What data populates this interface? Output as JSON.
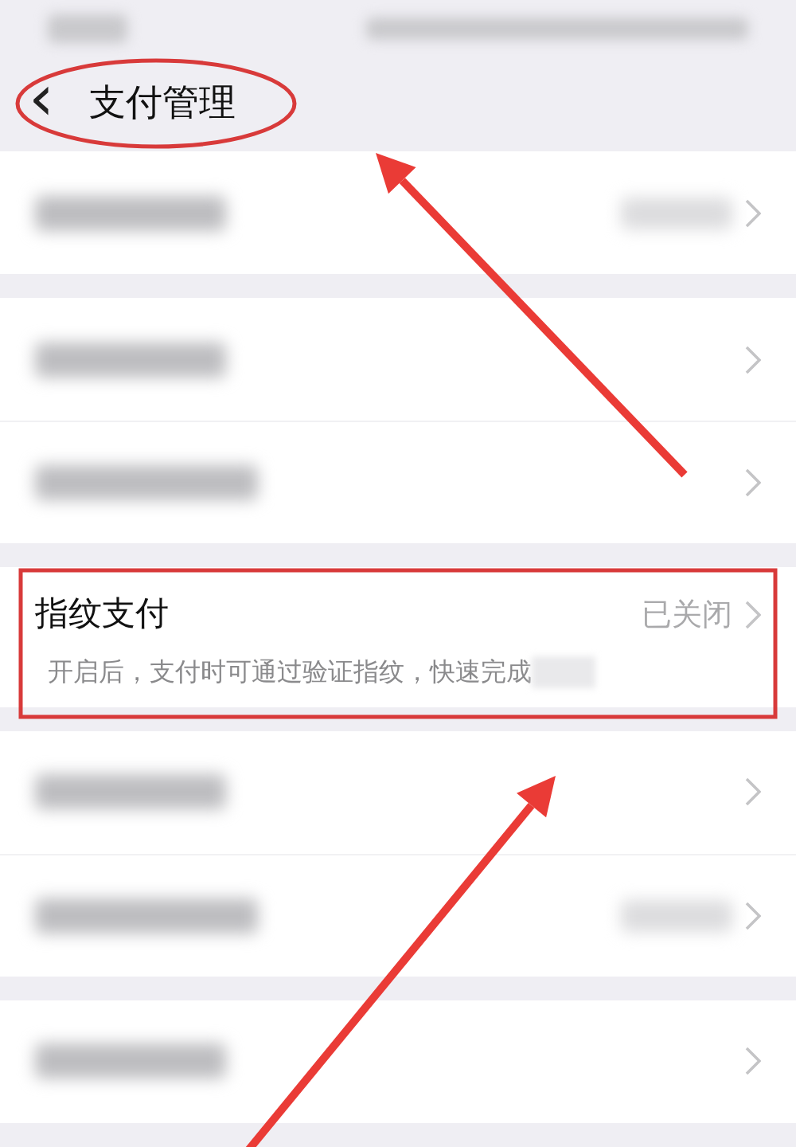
{
  "status_bar": {
    "blurred": true
  },
  "header": {
    "back_icon": "‹",
    "title": "支付管理"
  },
  "groups": [
    {
      "rows": [
        {
          "kind": "blurred",
          "value_blurred": true
        }
      ]
    },
    {
      "rows": [
        {
          "kind": "blurred",
          "value_blurred": false
        },
        {
          "kind": "blurred",
          "value_blurred": false
        }
      ]
    },
    {
      "rows": [
        {
          "kind": "setting",
          "title": "指纹支付",
          "value": "已关闭",
          "description": "开启后，支付时可通过验证指纹，快速完成",
          "redacted_tail": true
        }
      ]
    },
    {
      "rows": [
        {
          "kind": "blurred",
          "value_blurred": false
        },
        {
          "kind": "blurred",
          "value_blurred": true
        }
      ]
    },
    {
      "rows": [
        {
          "kind": "blurred",
          "value_blurred": false
        }
      ]
    }
  ],
  "annotations": [
    {
      "kind": "ellipse"
    },
    {
      "kind": "box"
    },
    {
      "kind": "arrow"
    },
    {
      "kind": "arrow"
    }
  ]
}
